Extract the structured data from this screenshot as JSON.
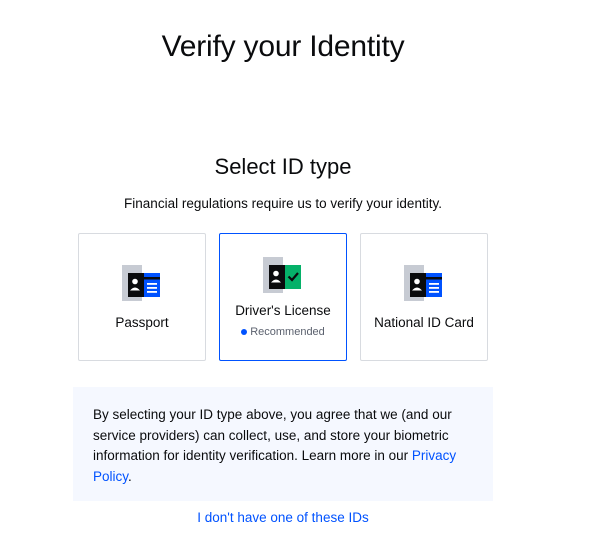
{
  "header": {
    "title": "Verify your Identity"
  },
  "main": {
    "heading": "Select ID type",
    "subtitle": "Financial regulations require us to verify your identity.",
    "id_options": [
      {
        "label": "Passport",
        "icon": "passport-icon",
        "selected": false
      },
      {
        "label": "Driver's License",
        "icon": "drivers-license-icon",
        "selected": true,
        "badge": "Recommended"
      },
      {
        "label": "National ID Card",
        "icon": "national-id-icon",
        "selected": false
      }
    ],
    "notice": {
      "text": "By selecting your ID type above, you agree that we (and our service providers) can collect, use, and store your biometric information for identity verification. Learn more in our ",
      "link_text": "Privacy Policy",
      "suffix": "."
    },
    "alt_link": "I don't have one of these IDs"
  },
  "colors": {
    "accent": "#0052ff",
    "text": "#0a0b0d",
    "card_border": "#d8dbe0",
    "notice_bg": "#f5f8ff",
    "license_check": "#05b169",
    "icon_dark": "#0a0b0d",
    "icon_gray": "#c7cbd3"
  }
}
